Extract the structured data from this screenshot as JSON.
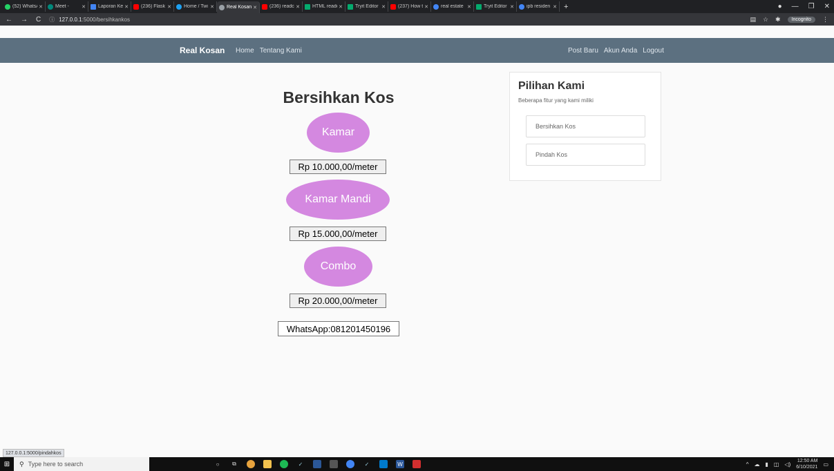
{
  "browser": {
    "tabs": [
      {
        "title": "(52) WhatsA",
        "color": "#25d366"
      },
      {
        "title": "Meet -",
        "color": "#00897b"
      },
      {
        "title": "Laporan Ke",
        "color": "#4285f4"
      },
      {
        "title": "(236) Flask",
        "color": "#ff0000"
      },
      {
        "title": "Home / Twi",
        "color": "#1da1f2"
      },
      {
        "title": "Real Kosan",
        "color": "#9aa0a6"
      },
      {
        "title": "(236) readc",
        "color": "#ff0000"
      },
      {
        "title": "HTML reade",
        "color": "#04aa6d"
      },
      {
        "title": "Tryit Editor",
        "color": "#04aa6d"
      },
      {
        "title": "(237) How t",
        "color": "#ff0000"
      },
      {
        "title": "real estate",
        "color": "#4285f4"
      },
      {
        "title": "Tryit Editor",
        "color": "#04aa6d"
      },
      {
        "title": "ipb residen",
        "color": "#4285f4"
      }
    ],
    "active_tab_index": 5,
    "url_host": "127.0.0.1",
    "url_path": ":5000/bersihkankos",
    "incognito_label": "Incognito",
    "status_url": "127.0.0.1:5000/pindahkos"
  },
  "navbar": {
    "brand": "Real Kosan",
    "left_links": [
      "Home",
      "Tentang Kami"
    ],
    "right_links": [
      "Post Baru",
      "Akun Anda",
      "Logout"
    ]
  },
  "main": {
    "title": "Bersihkan Kos",
    "services": [
      {
        "name": "Kamar",
        "price": "Rp 10.000,00/meter"
      },
      {
        "name": "Kamar Mandi",
        "price": "Rp 15.000,00/meter"
      },
      {
        "name": "Combo",
        "price": "Rp 20.000,00/meter"
      }
    ],
    "whatsapp": "WhatsApp:081201450196",
    "oval_color": "#d488e0"
  },
  "sidebar": {
    "title": "Pilihan Kami",
    "subtitle": "Beberapa fitur yang kami miliki",
    "items": [
      "Bersihkan Kos",
      "Pindah Kos"
    ]
  },
  "taskbar": {
    "search_placeholder": "Type here to search",
    "time": "12:50 AM",
    "date": "6/10/2021"
  }
}
